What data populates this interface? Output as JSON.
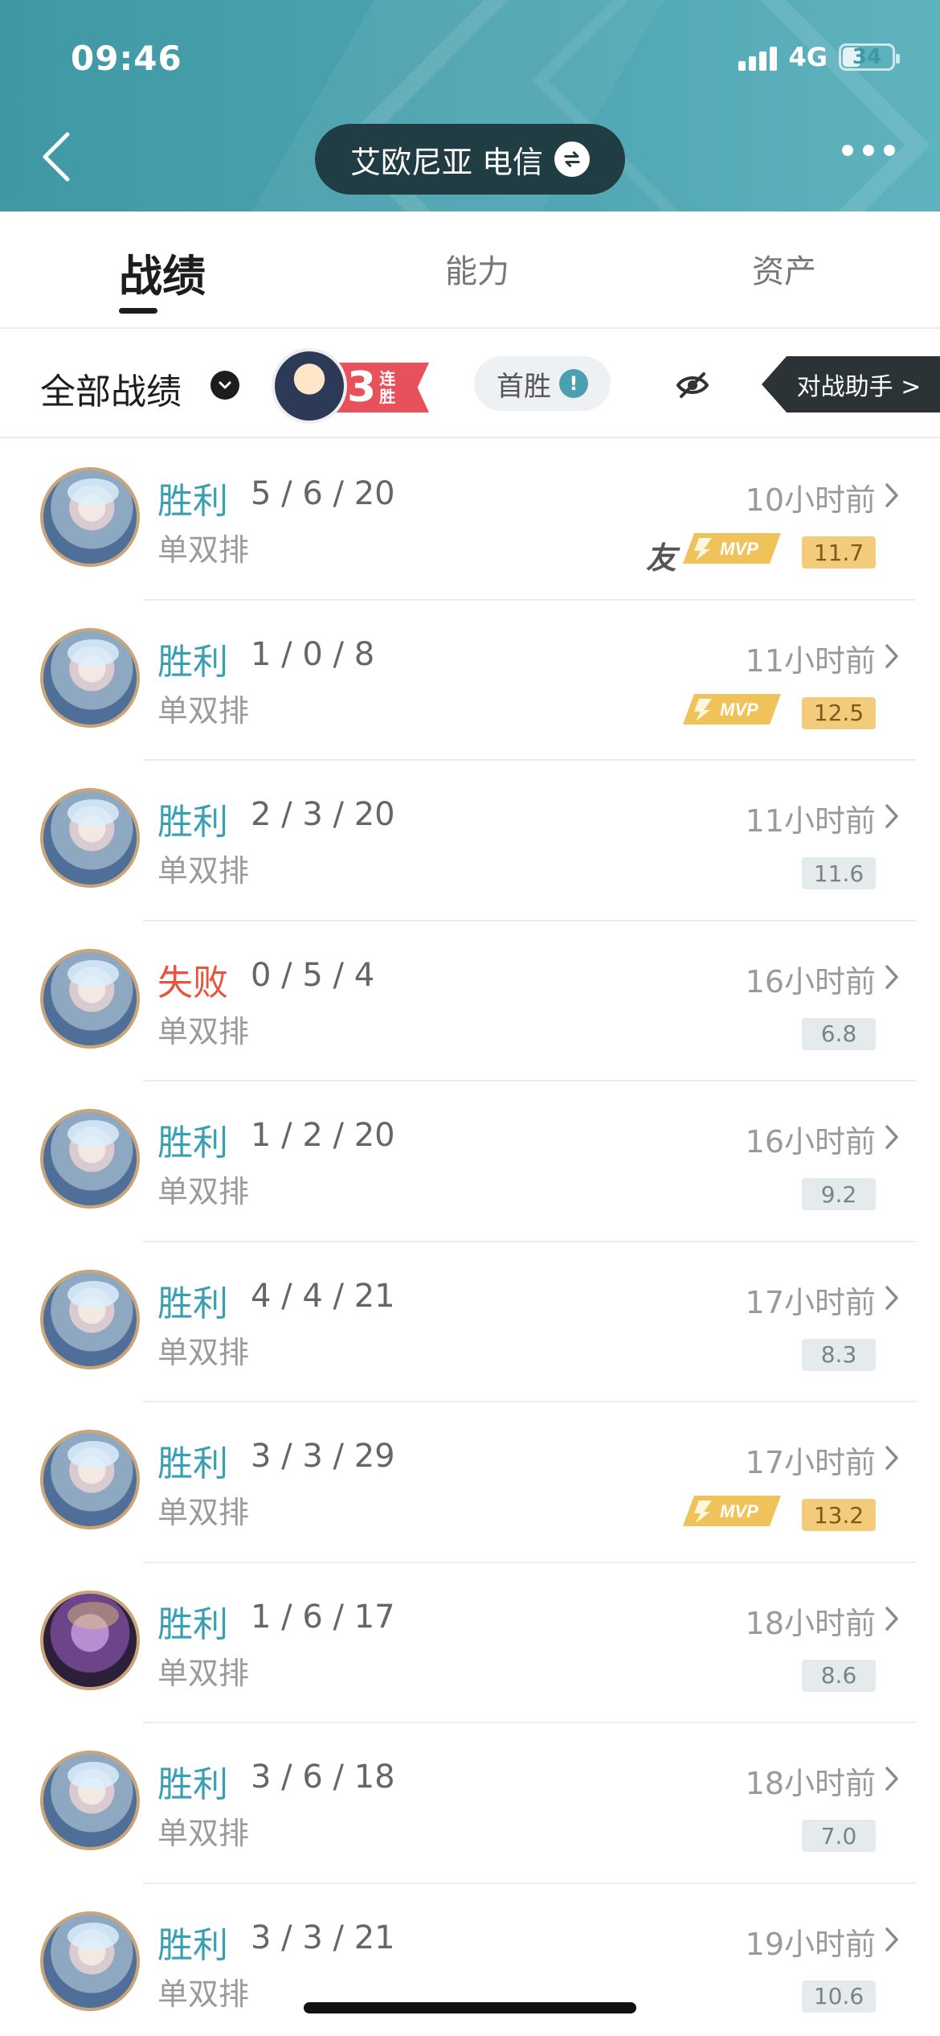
{
  "status_bar": {
    "time": "09:46",
    "network": "4G",
    "battery": "34"
  },
  "header": {
    "server_name": "艾欧尼亚 电信"
  },
  "tabs": [
    {
      "label": "战绩",
      "active": true
    },
    {
      "label": "能力",
      "active": false
    },
    {
      "label": "资产",
      "active": false
    }
  ],
  "filter": {
    "label": "全部战绩",
    "streak_count": "3",
    "streak_text": "连胜",
    "first_win_label": "首胜",
    "assist_label": "对战助手 >"
  },
  "matches": [
    {
      "result": "胜利",
      "outcome": "win",
      "kda": "5 / 6 / 20",
      "mode": "单双排",
      "time": "10小时前",
      "score": "11.7",
      "mvp": true,
      "friend": "友",
      "hero": "ice"
    },
    {
      "result": "胜利",
      "outcome": "win",
      "kda": "1 / 0 / 8",
      "mode": "单双排",
      "time": "11小时前",
      "score": "12.5",
      "mvp": true,
      "friend": "",
      "hero": "ice"
    },
    {
      "result": "胜利",
      "outcome": "win",
      "kda": "2 / 3 / 20",
      "mode": "单双排",
      "time": "11小时前",
      "score": "11.6",
      "mvp": false,
      "friend": "",
      "hero": "ice"
    },
    {
      "result": "失败",
      "outcome": "loss",
      "kda": "0 / 5 / 4",
      "mode": "单双排",
      "time": "16小时前",
      "score": "6.8",
      "mvp": false,
      "friend": "",
      "hero": "ice"
    },
    {
      "result": "胜利",
      "outcome": "win",
      "kda": "1 / 2 / 20",
      "mode": "单双排",
      "time": "16小时前",
      "score": "9.2",
      "mvp": false,
      "friend": "",
      "hero": "ice"
    },
    {
      "result": "胜利",
      "outcome": "win",
      "kda": "4 / 4 / 21",
      "mode": "单双排",
      "time": "17小时前",
      "score": "8.3",
      "mvp": false,
      "friend": "",
      "hero": "ice"
    },
    {
      "result": "胜利",
      "outcome": "win",
      "kda": "3 / 3 / 29",
      "mode": "单双排",
      "time": "17小时前",
      "score": "13.2",
      "mvp": true,
      "friend": "",
      "hero": "ice"
    },
    {
      "result": "胜利",
      "outcome": "win",
      "kda": "1 / 6 / 17",
      "mode": "单双排",
      "time": "18小时前",
      "score": "8.6",
      "mvp": false,
      "friend": "",
      "hero": "dark"
    },
    {
      "result": "胜利",
      "outcome": "win",
      "kda": "3 / 6 / 18",
      "mode": "单双排",
      "time": "18小时前",
      "score": "7.0",
      "mvp": false,
      "friend": "",
      "hero": "ice"
    },
    {
      "result": "胜利",
      "outcome": "win",
      "kda": "3 / 3 / 21",
      "mode": "单双排",
      "time": "19小时前",
      "score": "10.6",
      "mvp": false,
      "friend": "",
      "hero": "ice"
    }
  ],
  "colors": {
    "win": "#3a9fb3",
    "loss": "#e5553e",
    "header": "#4ea5b1",
    "mvp": "#f2cc7a"
  }
}
